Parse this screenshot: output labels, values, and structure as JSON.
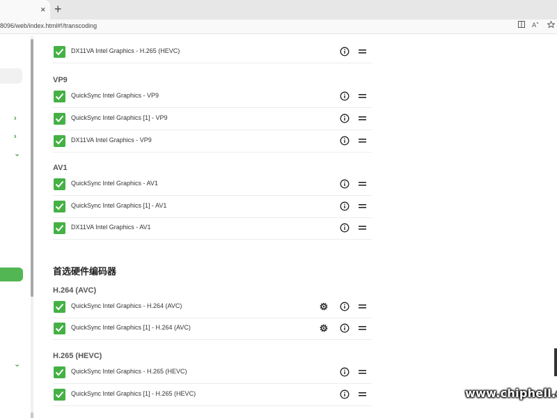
{
  "browser": {
    "tab_close": "×",
    "new_tab": "+",
    "url": "8096/web/index.html#!/transcoding",
    "icons": [
      "reader-view-icon",
      "read-aloud-icon",
      "favorites-icon"
    ]
  },
  "decoders": {
    "hevc_rows": [
      {
        "label": "DX11VA Intel Graphics - H.265 (HEVC)"
      }
    ],
    "vp9": {
      "title": "VP9",
      "rows": [
        {
          "label": "QuickSync Intel Graphics - VP9"
        },
        {
          "label": "QuickSync Intel Graphics [1] - VP9"
        },
        {
          "label": "DX11VA Intel Graphics - VP9"
        }
      ]
    },
    "av1": {
      "title": "AV1",
      "rows": [
        {
          "label": "QuickSync Intel Graphics - AV1"
        },
        {
          "label": "QuickSync Intel Graphics [1] - AV1"
        },
        {
          "label": "DX11VA Intel Graphics - AV1"
        }
      ]
    }
  },
  "encoders": {
    "title": "首选硬件编码器",
    "h264": {
      "title": "H.264 (AVC)",
      "rows": [
        {
          "label": "QuickSync Intel Graphics - H.264 (AVC)"
        },
        {
          "label": "QuickSync Intel Graphics [1] - H.264 (AVC)"
        }
      ]
    },
    "h265": {
      "title": "H.265 (HEVC)",
      "rows": [
        {
          "label": "QuickSync Intel Graphics - H.265 (HEVC)"
        },
        {
          "label": "QuickSync Intel Graphics [1] - H.265 (HEVC)"
        }
      ]
    }
  },
  "watermark": "www.chiphell.com",
  "colors": {
    "accent": "#45b145",
    "sidebar_active": "#52b752"
  }
}
